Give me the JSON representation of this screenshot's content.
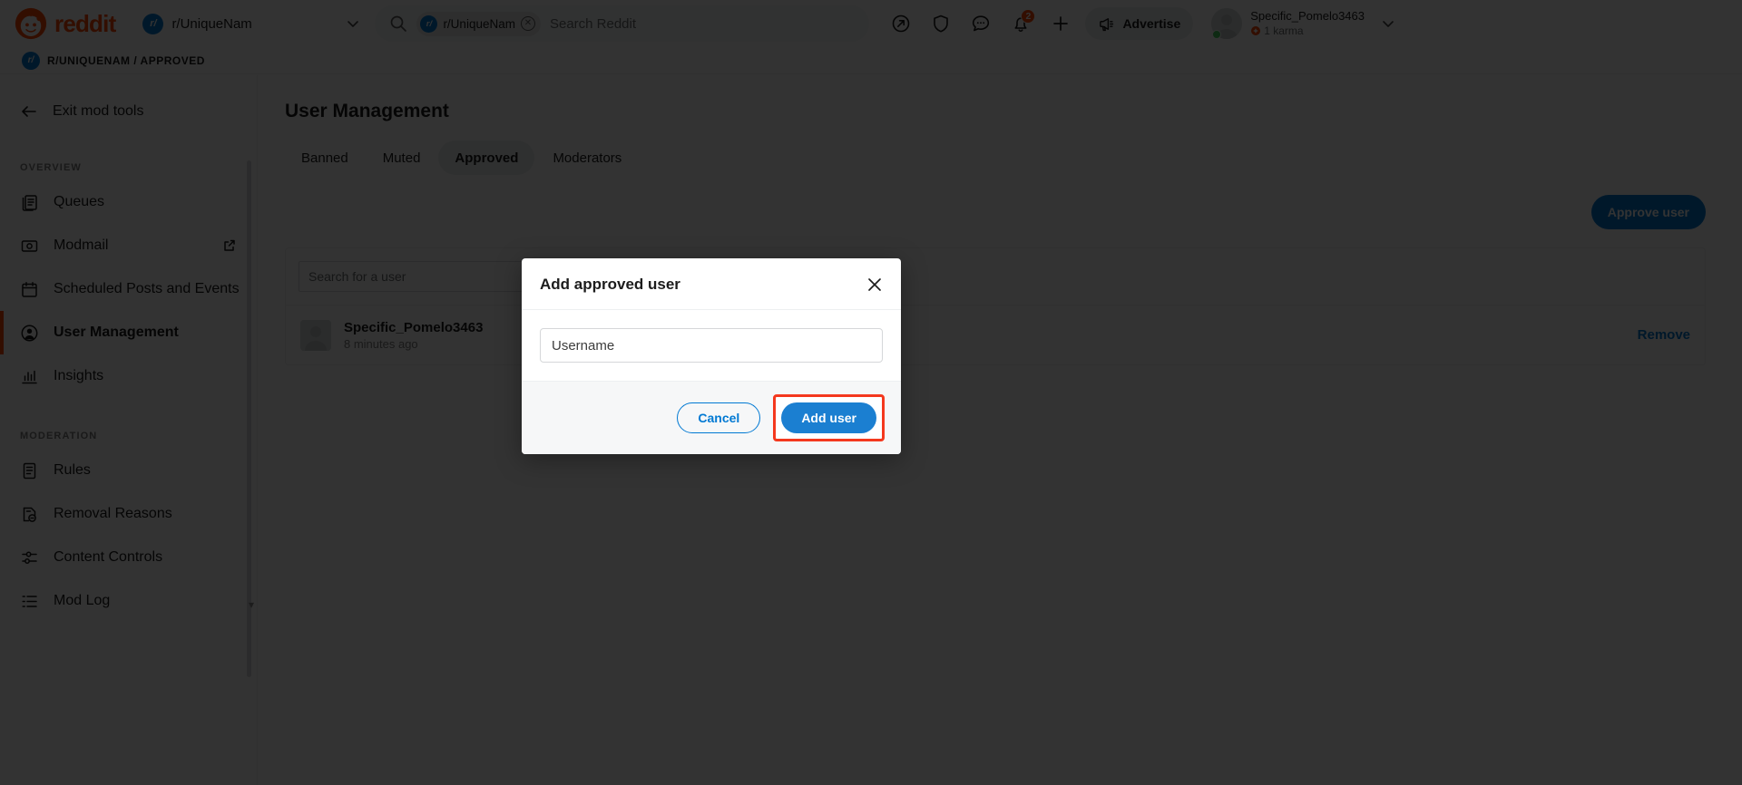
{
  "header": {
    "logo_word": "reddit",
    "subreddit": {
      "name": "r/UniqueNam",
      "avatar_letter": "r/"
    },
    "search": {
      "chip_label": "r/UniqueNam",
      "placeholder": "Search Reddit",
      "value": ""
    },
    "icons": [
      {
        "name": "popular-icon",
        "label": "Popular"
      },
      {
        "name": "mod-shield-icon",
        "label": "Mod"
      },
      {
        "name": "chat-icon",
        "label": "Chat"
      },
      {
        "name": "notifications-icon",
        "label": "Notifications",
        "badge": "2"
      },
      {
        "name": "create-icon",
        "label": "Create"
      }
    ],
    "advertise_label": "Advertise",
    "user": {
      "username": "Specific_Pomelo3463",
      "karma": "1 karma"
    }
  },
  "breadcrumb": {
    "text": "R/UNIQUENAM / APPROVED",
    "avatar_letter": "r/"
  },
  "sidebar": {
    "exit_label": "Exit mod tools",
    "sections": [
      {
        "title": "OVERVIEW",
        "items": [
          {
            "label": "Queues",
            "icon": "queues-icon",
            "active": false,
            "external": false
          },
          {
            "label": "Modmail",
            "icon": "modmail-icon",
            "active": false,
            "external": true
          },
          {
            "label": "Scheduled Posts and Events",
            "icon": "calendar-icon",
            "active": false,
            "external": false
          },
          {
            "label": "User Management",
            "icon": "user-icon",
            "active": true,
            "external": false
          },
          {
            "label": "Insights",
            "icon": "insights-icon",
            "active": false,
            "external": false
          }
        ]
      },
      {
        "title": "MODERATION",
        "items": [
          {
            "label": "Rules",
            "icon": "rules-icon",
            "active": false,
            "external": false
          },
          {
            "label": "Removal Reasons",
            "icon": "removal-reasons-icon",
            "active": false,
            "external": false
          },
          {
            "label": "Content Controls",
            "icon": "content-controls-icon",
            "active": false,
            "external": false
          },
          {
            "label": "Mod Log",
            "icon": "mod-log-icon",
            "active": false,
            "external": false
          }
        ]
      }
    ]
  },
  "main": {
    "title": "User Management",
    "tabs": [
      {
        "label": "Banned",
        "active": false
      },
      {
        "label": "Muted",
        "active": false
      },
      {
        "label": "Approved",
        "active": true
      },
      {
        "label": "Moderators",
        "active": false
      }
    ],
    "approve_user_label": "Approve user",
    "user_search": {
      "placeholder": "Search for a user",
      "value": ""
    },
    "rows": [
      {
        "username": "Specific_Pomelo3463",
        "timestamp": "8 minutes ago",
        "action_label": "Remove"
      }
    ]
  },
  "modal": {
    "title": "Add approved user",
    "close_icon": "close-icon",
    "username_field": {
      "placeholder": "Username",
      "value": ""
    },
    "cancel_label": "Cancel",
    "submit_label": "Add user"
  },
  "colors": {
    "brand_orange": "#ff4500",
    "link_blue": "#0079d3",
    "button_blue": "#1b7fd1",
    "highlight_red": "#f4381e",
    "online_green": "#46d160"
  }
}
